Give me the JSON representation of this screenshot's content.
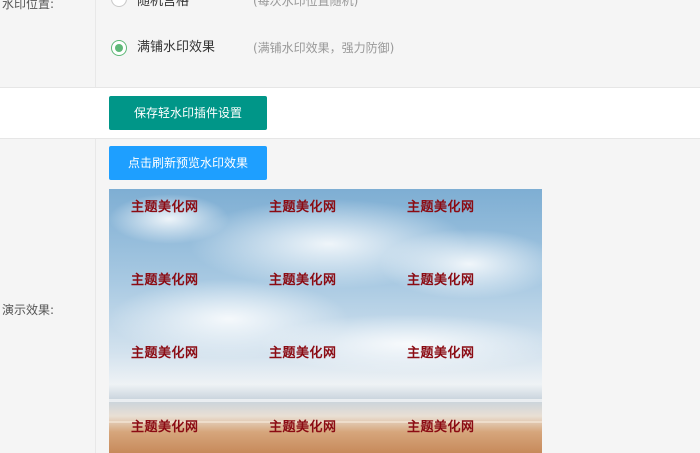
{
  "position_field": {
    "label": "水印位置:",
    "options": [
      {
        "label": "随机宫格",
        "desc": "(每次水印位置随机)",
        "selected": false
      },
      {
        "label": "满铺水印效果",
        "desc": "(满铺水印效果，强力防御)",
        "selected": true
      }
    ]
  },
  "save_button": {
    "label": "保存轻水印插件设置"
  },
  "demo_field": {
    "label": "演示效果:",
    "refresh_button": "点击刷新预览水印效果",
    "watermark_text": "主题美化网",
    "colors": {
      "watermark": "#8b0b13",
      "save_button": "#009688",
      "refresh_button": "#1e9fff",
      "radio_checked": "#5fb878"
    }
  }
}
